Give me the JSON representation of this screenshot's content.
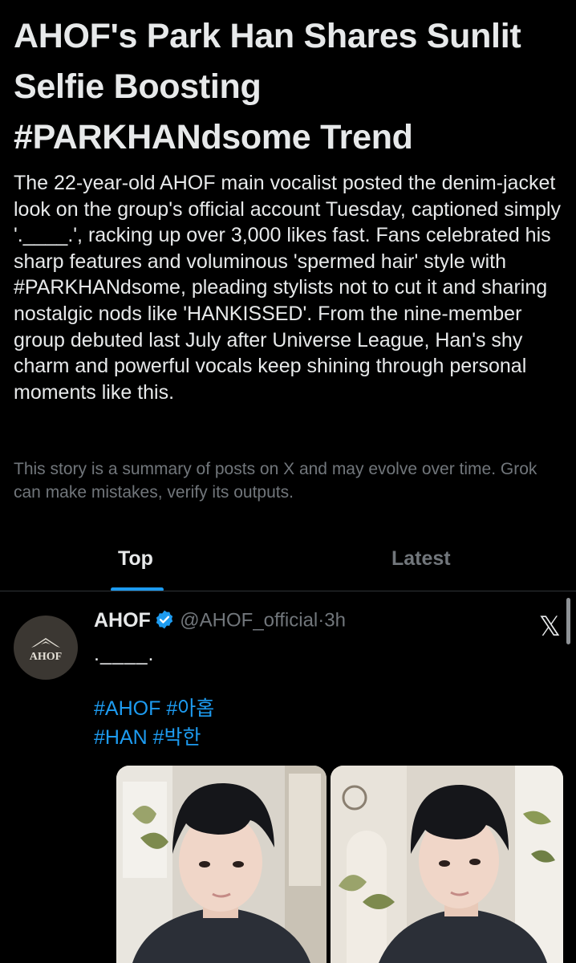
{
  "story": {
    "headline": "AHOF's Park Han Shares Sunlit Selfie Boosting #PARKHANdsome Trend",
    "summary": "The 22-year-old AHOF main vocalist posted the denim-jacket look on the group's official account Tuesday, captioned simply '.____.', racking up over 3,000 likes fast. Fans celebrated his sharp features and voluminous 'spermed hair' style with #PARKHANdsome, pleading stylists not to cut it and sharing nostalgic nods like 'HANKISSED'. From the nine-member group debuted last July after Universe League, Han's shy charm and powerful vocals keep shining through personal moments like this.",
    "disclaimer": "This story is a summary of posts on X and may evolve over time. Grok can make mistakes, verify its outputs."
  },
  "tabs": [
    {
      "label": "Top",
      "active": true
    },
    {
      "label": "Latest",
      "active": false
    }
  ],
  "post": {
    "avatar_text": "AHOF",
    "display_name": "AHOF",
    "verified_icon": "verified-badge-icon",
    "handle": "@AHOF_official",
    "separator": "·",
    "time": "3h",
    "source_icon": "x-logo-icon",
    "source_glyph": "𝕏",
    "text": ".____.",
    "hashtags_line1": [
      "#AHOF",
      "#아홉"
    ],
    "hashtags_line2": [
      "#HAN",
      "#박한"
    ],
    "media": [
      {
        "icon": "photo-selfie-image"
      },
      {
        "icon": "photo-selfie-image"
      }
    ]
  },
  "colors": {
    "background": "#000000",
    "text": "#e7e9ea",
    "muted": "#71767b",
    "accent": "#1d9bf0",
    "divider": "#2f3336"
  }
}
